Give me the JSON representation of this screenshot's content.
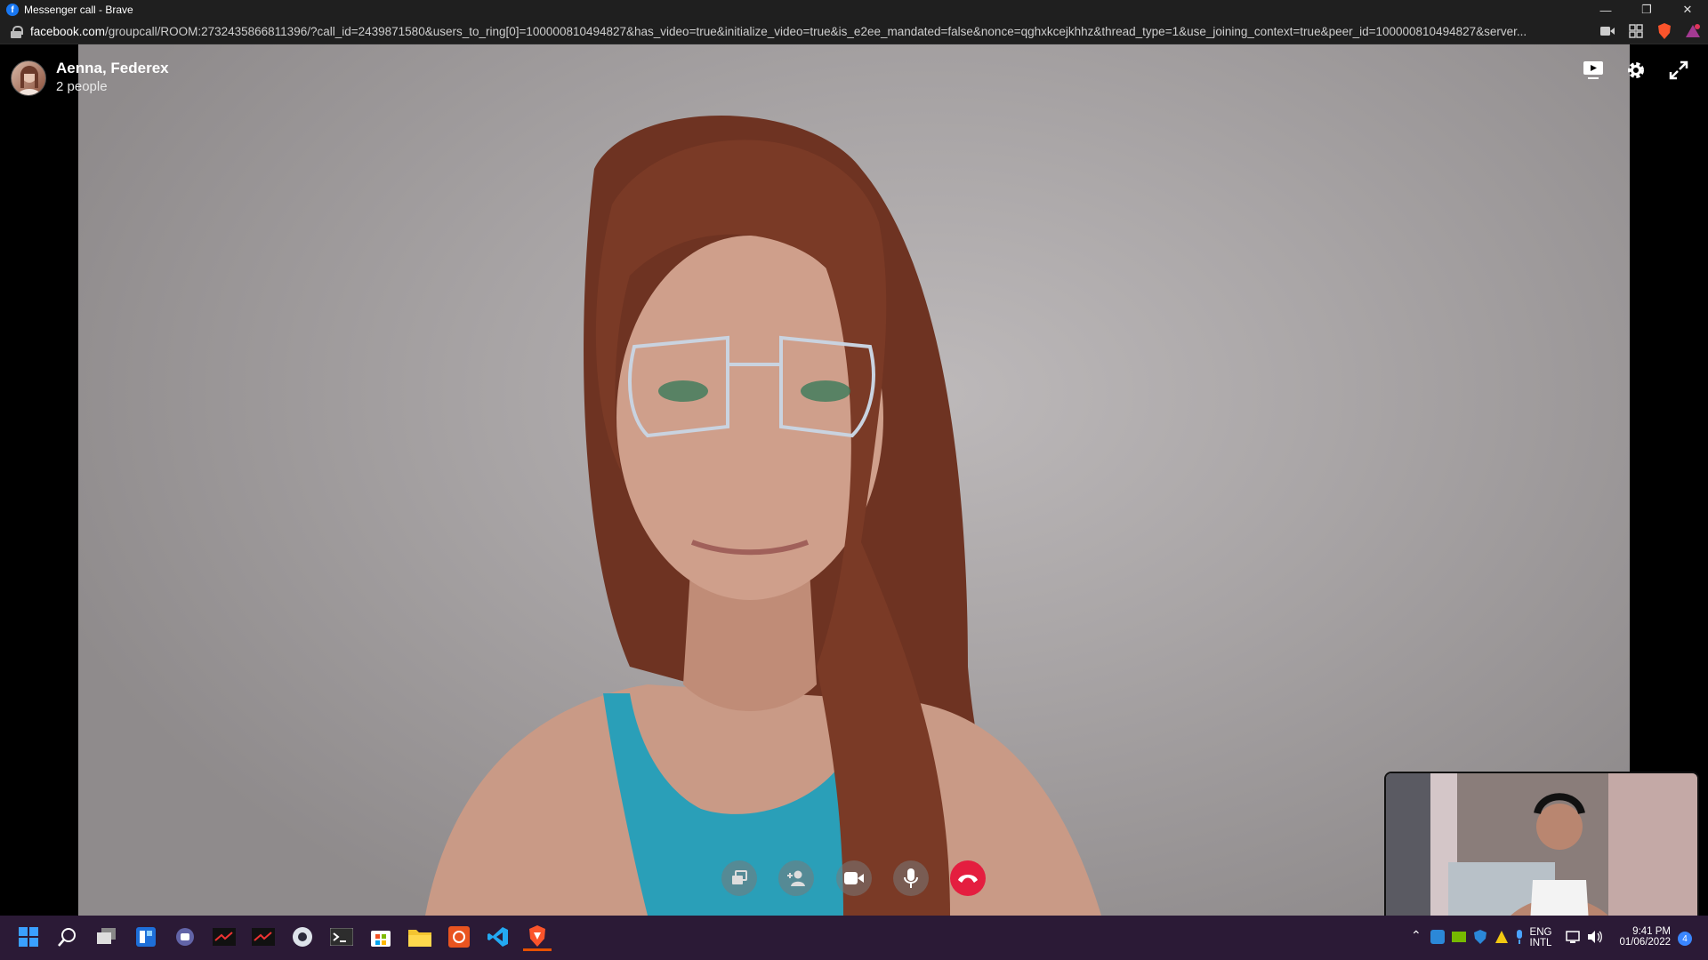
{
  "window": {
    "title": "Messenger call - Brave",
    "controls": [
      "minimize",
      "restore",
      "close"
    ]
  },
  "addressbar": {
    "host": "facebook.com",
    "path": "/groupcall/ROOM:2732435866811396/?call_id=2439871580&users_to_ring[0]=100000810494827&has_video=true&initialize_video=true&is_e2ee_mandated=false&nonce=qghxkcejkhhz&thread_type=1&use_joining_context=true&peer_id=100000810494827&server...",
    "icons": [
      "camera-icon",
      "extensions-icon",
      "brave-shield-icon",
      "brave-rewards-icon"
    ]
  },
  "call": {
    "participants_title": "Aenna, Federex",
    "participant_count": "2 people",
    "top_actions": [
      "share-screen-icon",
      "settings-icon",
      "fullscreen-icon"
    ],
    "controls": [
      {
        "name": "switch-view-button",
        "icon": "layers-icon"
      },
      {
        "name": "add-people-button",
        "icon": "add-person-icon"
      },
      {
        "name": "camera-toggle-button",
        "icon": "video-camera-icon"
      },
      {
        "name": "mute-button",
        "icon": "microphone-icon"
      },
      {
        "name": "end-call-button",
        "icon": "hang-up-icon"
      }
    ]
  },
  "taskbar": {
    "apps": [
      "start-icon",
      "search-icon",
      "task-view-icon",
      "widgets-icon",
      "teams-chat-icon",
      "app-terminal-a-icon",
      "app-terminal-b-icon",
      "chrome-like-icon",
      "terminal-icon",
      "store-icon",
      "file-explorer-icon",
      "ubuntu-icon",
      "vscode-icon",
      "brave-icon"
    ],
    "tray": {
      "lang_line1": "ENG",
      "lang_line2": "INTL",
      "time": "9:41 PM",
      "date": "01/06/2022",
      "notification_count": "4"
    }
  },
  "colors": {
    "end_call": "#e41e3f",
    "taskbar": "#2b1a36",
    "facebook": "#1877f2"
  }
}
